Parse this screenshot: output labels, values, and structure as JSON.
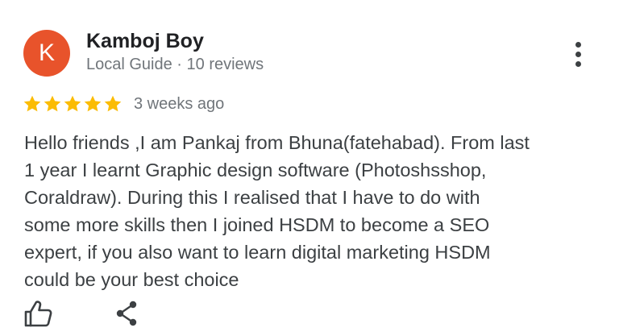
{
  "reviewer": {
    "initial": "K",
    "name": "Kamboj Boy",
    "meta": "Local Guide · 10 reviews",
    "avatar_color": "#e8532b"
  },
  "rating": {
    "stars": 5,
    "max_stars": 5,
    "star_color": "#fbbc04",
    "time": "3 weeks ago"
  },
  "review_lines": [
    "Hello friends ,I am Pankaj from Bhuna(fatehabad). From last",
    "1 year I learnt Graphic design software (Photoshsshop,",
    "Coraldraw). During this I realised that I have to do with",
    "some more skills then I joined HSDM to become a SEO",
    "expert, if you also want to learn digital marketing HSDM",
    "could be your best choice"
  ],
  "icons": {
    "more": "more-vertical-icon",
    "like": "thumbs-up-icon",
    "share": "share-icon",
    "star": "star-icon"
  }
}
